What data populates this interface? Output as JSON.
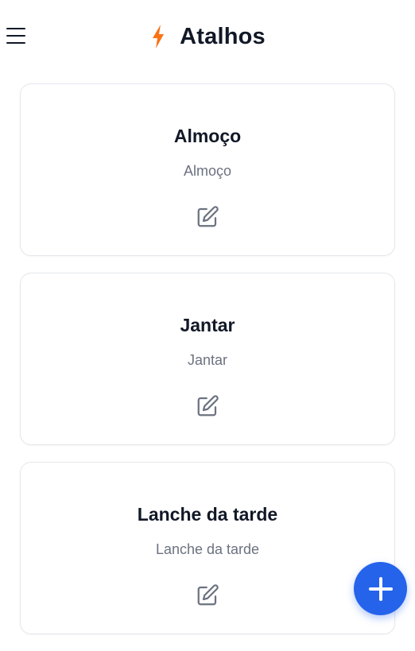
{
  "header": {
    "title": "Atalhos",
    "menu_icon": "hamburger-menu-icon",
    "title_icon": "lightning-bolt-icon"
  },
  "colors": {
    "accent_orange": "#f97316",
    "fab_blue": "#2563eb",
    "muted_text": "#6b7280",
    "card_border": "#e5e7eb"
  },
  "shortcuts": [
    {
      "title": "Almoço",
      "subtitle": "Almoço",
      "action_icon": "edit-icon"
    },
    {
      "title": "Jantar",
      "subtitle": "Jantar",
      "action_icon": "edit-icon"
    },
    {
      "title": "Lanche da tarde",
      "subtitle": "Lanche da tarde",
      "action_icon": "edit-icon"
    }
  ],
  "fab": {
    "icon": "plus-icon"
  }
}
